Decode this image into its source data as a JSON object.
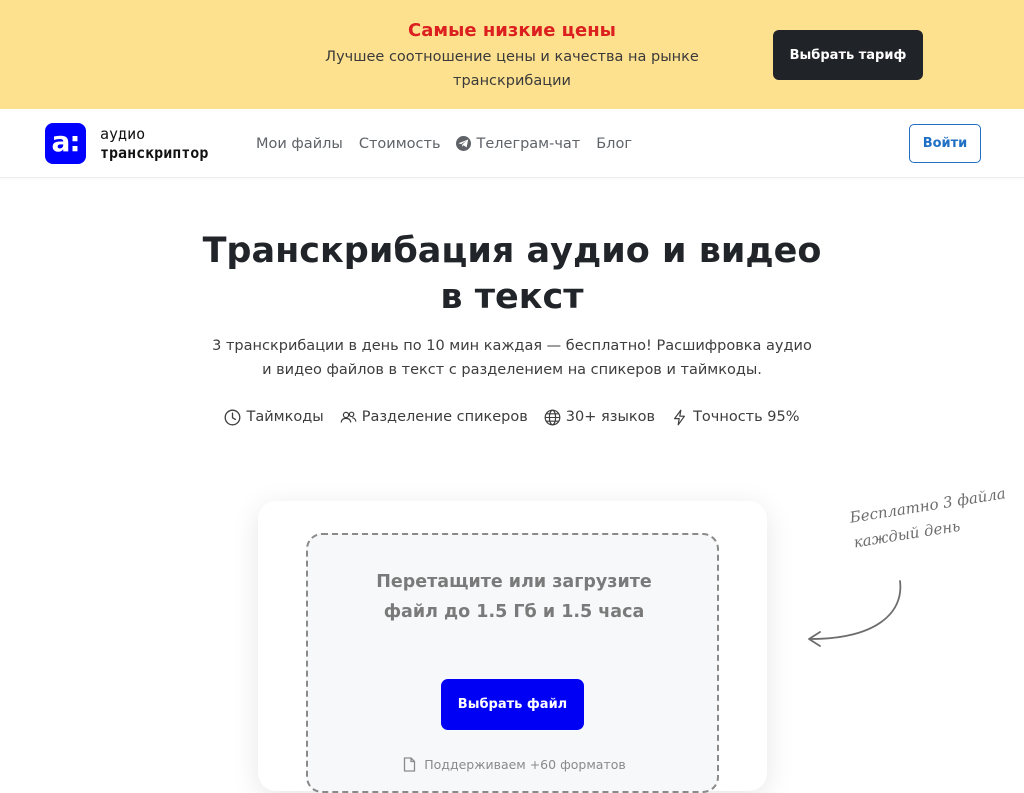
{
  "promo": {
    "title": "Самые низкие цены",
    "subtitle": "Лучшее соотношение цены и качества на рынке транскрибации",
    "button_label": "Выбрать тариф",
    "background_color": "#fde18f",
    "title_color": "#dc1f1f"
  },
  "header": {
    "logo_glyph": "a:",
    "logo_line1": "аудио",
    "logo_line2": "транскриптор",
    "nav": [
      {
        "label": "Мои файлы",
        "icon": ""
      },
      {
        "label": "Стоимость",
        "icon": ""
      },
      {
        "label": "Телеграм-чат",
        "icon": "telegram-icon"
      },
      {
        "label": "Блог",
        "icon": ""
      }
    ],
    "login_label": "Войти",
    "brand_color": "#0000ff"
  },
  "hero": {
    "title": "Транскрибация аудио и видео в текст",
    "subtitle": "3 транскрибации в день по 10 мин каждая — бесплатно! Расшифровка аудио и видео файлов в текст с разделением на спикеров и таймкоды.",
    "features": [
      {
        "label": "Таймкоды",
        "icon": "clock-icon"
      },
      {
        "label": "Разделение спикеров",
        "icon": "users-icon"
      },
      {
        "label": "30+ языков",
        "icon": "globe-icon"
      },
      {
        "label": "Точность 95%",
        "icon": "lightning-icon"
      }
    ]
  },
  "upload": {
    "drop_text": "Перетащите или загрузите файл до 1.5 Гб и 1.5 часа",
    "button_label": "Выбрать файл",
    "formats_text": "Поддерживаем +60 форматов",
    "button_color": "#0000f5"
  },
  "note": {
    "line1": "Бесплатно 3 файла",
    "line2": "каждый день"
  }
}
